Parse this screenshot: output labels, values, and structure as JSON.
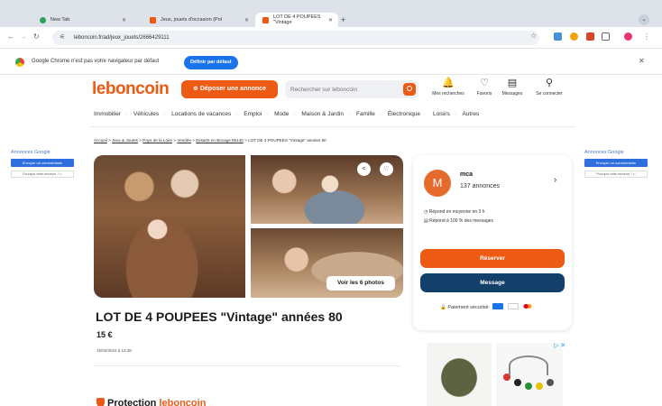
{
  "browser": {
    "tabs": [
      {
        "label": "New Tab",
        "favicon_color": "#2ba35f"
      },
      {
        "label": "Jeux, jouets d'occasion (Pol",
        "favicon_color": "#ec5a13"
      },
      {
        "label": "LOT DE 4 POUPEES \"Vintage",
        "favicon_color": "#ec5a13"
      }
    ],
    "new_tab_glyph": "+",
    "tab_menu_glyph": "⌄",
    "url": "leboncoin.fr/ad/jeux_jouets/2666429111",
    "infobar": {
      "message": "Google Chrome n'est pas votre navigateur par défaut",
      "button": "Définir par défaut"
    }
  },
  "site": {
    "logo": "leboncoin",
    "deposit_button": "⊕ Déposer une annonce",
    "search_placeholder": "Rechercher sur leboncoin",
    "header_links": [
      {
        "icon": "bell-icon",
        "glyph": "🔔",
        "label": "Mes recherches"
      },
      {
        "icon": "heart-icon",
        "glyph": "♡",
        "label": "Favoris"
      },
      {
        "icon": "message-icon",
        "glyph": "▤",
        "label": "Messages"
      },
      {
        "icon": "user-icon",
        "glyph": "⚲",
        "label": "Se connecter"
      }
    ],
    "categories": [
      "Immobilier",
      "Véhicules",
      "Locations de vacances",
      "Emploi",
      "Mode",
      "Maison & Jardin",
      "Famille",
      "Électronique",
      "Loisirs",
      "Autres"
    ]
  },
  "side_ads": {
    "label": "Annonces Google",
    "button": "Envoyer un commentaire",
    "why": "Pourquoi cette annonce ? ▷"
  },
  "breadcrumb": {
    "items": [
      "Accueil",
      "Jeux & Jouets",
      "Pays de la Loire",
      "Vendée",
      "Essarts en Bocage 85140"
    ],
    "current": "LOT DE 4 POUPEES \"Vintage\" années 80"
  },
  "gallery": {
    "share_glyph": "<",
    "fav_glyph": "♡",
    "see_photos": "Voir les 6 photos"
  },
  "listing": {
    "title": "LOT DE 4 POUPEES \"Vintage\" années 80",
    "price": "15 €",
    "date": "16/02/2024 à 13:38",
    "protection_prefix": "Protection",
    "protection_brand": "leboncoin"
  },
  "seller": {
    "initial": "M",
    "name": "mca",
    "ads_count": "137 annonces",
    "response_time": "Répond en moyenne en 3 h",
    "response_rate": "Répond à 100 % des messages",
    "reserve_button": "Réserver",
    "message_button": "Message",
    "secure_payment": "Paiement sécurisé"
  },
  "right_ad": {
    "choice_glyph": "▷ ✕"
  },
  "colors": {
    "brand": "#ec5a13",
    "message_button": "#13406a",
    "chrome_blue": "#1a73e8"
  }
}
